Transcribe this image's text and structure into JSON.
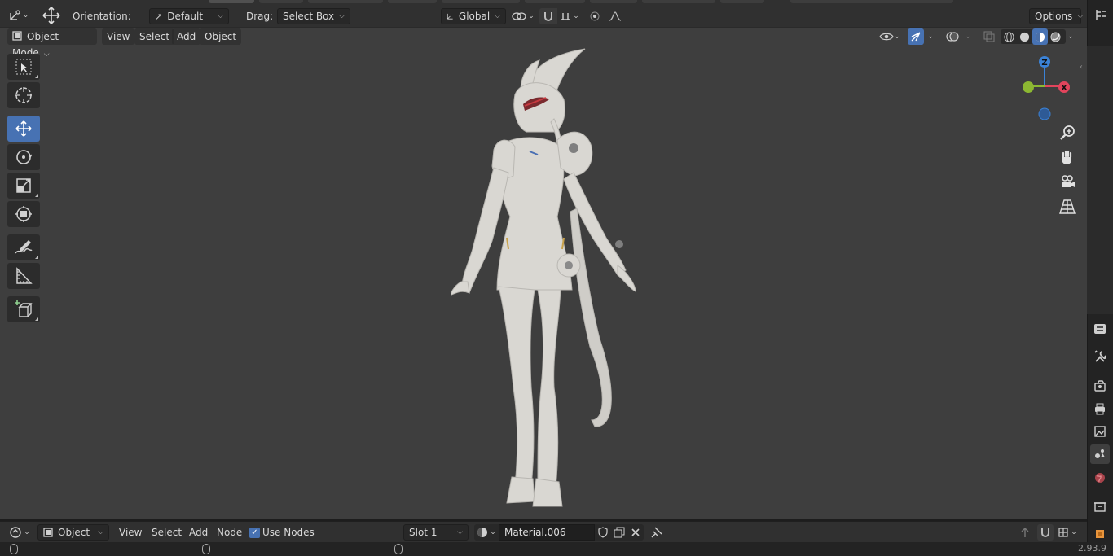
{
  "tool_header": {
    "orientation_label": "Orientation:",
    "orientation_value": "Default",
    "drag_label": "Drag:",
    "drag_value": "Select Box",
    "transform_orientation": "Global",
    "options_label": "Options"
  },
  "viewport_header": {
    "mode": "Object Mode",
    "menus": [
      "View",
      "Select",
      "Add",
      "Object"
    ]
  },
  "toolbar": {
    "tools": [
      "select-box-tool",
      "cursor-tool",
      "move-tool",
      "rotate-tool",
      "scale-tool",
      "transform-tool",
      "annotate-tool",
      "measure-tool",
      "add-cube-tool"
    ],
    "active": "move-tool"
  },
  "gizmo": {
    "z": "Z",
    "x": "X"
  },
  "node_header": {
    "editor_type": "Object",
    "menus": [
      "View",
      "Select",
      "Add",
      "Node"
    ],
    "use_nodes_label": "Use Nodes",
    "use_nodes_checked": true,
    "slot": "Slot 1",
    "material": "Material.006"
  },
  "status_bar": {
    "version": "2.93.9"
  },
  "colors": {
    "accent": "#4772b3",
    "viewport_bg": "#3e3e3e",
    "header_bg": "#303030",
    "axis_x": "#e2445c",
    "axis_y": "#8cb832",
    "axis_z": "#3b82d6",
    "model": "#d9d7d2"
  }
}
